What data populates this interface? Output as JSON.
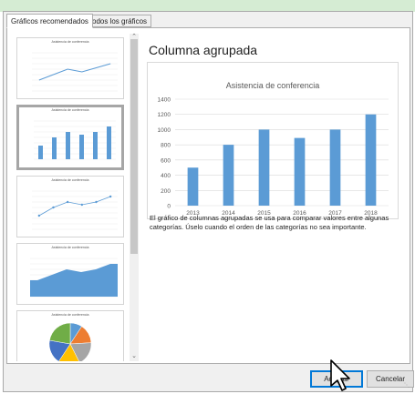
{
  "tabs": [
    {
      "label": "Gráficos recomendados",
      "active": true
    },
    {
      "label": "Todos los gráficos",
      "active": false
    }
  ],
  "thumbnails": [
    {
      "title": "Asistencia de conferencia",
      "type": "line",
      "values": [
        400,
        600,
        800,
        700,
        850,
        1000
      ]
    },
    {
      "title": "Asistencia de conferencia",
      "type": "bar",
      "values": [
        500,
        800,
        1000,
        900,
        1000,
        1200
      ],
      "selected": true
    },
    {
      "title": "Asistencia de conferencia",
      "type": "line-markers",
      "values": [
        500,
        800,
        1000,
        900,
        1000,
        1200
      ]
    },
    {
      "title": "Asistencia de conferencia",
      "type": "area",
      "values": [
        600,
        800,
        1000,
        900,
        1000,
        1200
      ]
    },
    {
      "title": "Asistencia de conferencia",
      "type": "pie",
      "values": [
        500,
        800,
        1000,
        900,
        1000,
        1200
      ]
    }
  ],
  "preview": {
    "heading": "Columna agrupada",
    "description": "El gráfico de columnas agrupadas se usa para comparar valores entre algunas categorías. Úselo cuando el orden de las categorías no sea importante."
  },
  "chart_data": {
    "type": "bar",
    "title": "Asistencia de conferencia",
    "categories": [
      "2013",
      "2014",
      "2015",
      "2016",
      "2017",
      "2018"
    ],
    "values": [
      500,
      800,
      1000,
      890,
      1000,
      1200
    ],
    "ylim": [
      0,
      1400
    ],
    "yticks": [
      "0",
      "200",
      "400",
      "600",
      "800",
      "1000",
      "1200",
      "1400"
    ],
    "grid": true,
    "color": "#5b9bd5"
  },
  "buttons": {
    "ok": "Aceptar",
    "cancel": "Cancelar"
  },
  "colors": {
    "accent": "#0078d7",
    "bar": "#5b9bd5",
    "pie": [
      "#5b9bd5",
      "#ed7d31",
      "#a5a5a5",
      "#ffc000",
      "#4472c4",
      "#70ad47"
    ]
  }
}
